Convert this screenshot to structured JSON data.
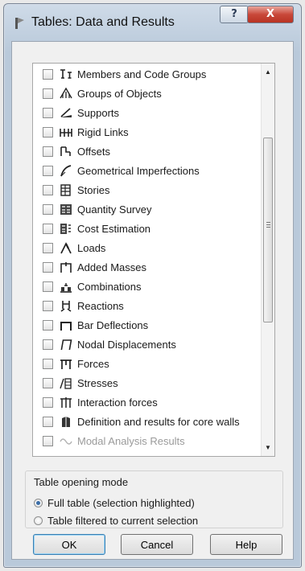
{
  "window": {
    "title": "Tables: Data and Results",
    "help_label": "?",
    "close_label": "X"
  },
  "list": {
    "items": [
      {
        "label": "Members and Code Groups",
        "icon": "members-icon",
        "checked": false
      },
      {
        "label": "Groups of Objects",
        "icon": "groups-icon",
        "checked": false
      },
      {
        "label": "Supports",
        "icon": "supports-icon",
        "checked": false
      },
      {
        "label": "Rigid Links",
        "icon": "rigid-links-icon",
        "checked": false
      },
      {
        "label": "Offsets",
        "icon": "offsets-icon",
        "checked": false
      },
      {
        "label": "Geometrical Imperfections",
        "icon": "imperfections-icon",
        "checked": false
      },
      {
        "label": "Stories",
        "icon": "stories-icon",
        "checked": false
      },
      {
        "label": "Quantity Survey",
        "icon": "quantity-survey-icon",
        "checked": false
      },
      {
        "label": "Cost Estimation",
        "icon": "cost-estimation-icon",
        "checked": false
      },
      {
        "label": "Loads",
        "icon": "loads-icon",
        "checked": false
      },
      {
        "label": "Added Masses",
        "icon": "added-masses-icon",
        "checked": false
      },
      {
        "label": "Combinations",
        "icon": "combinations-icon",
        "checked": false
      },
      {
        "label": "Reactions",
        "icon": "reactions-icon",
        "checked": false
      },
      {
        "label": "Bar Deflections",
        "icon": "bar-deflections-icon",
        "checked": false
      },
      {
        "label": "Nodal Displacements",
        "icon": "nodal-displacements-icon",
        "checked": false
      },
      {
        "label": "Forces",
        "icon": "forces-icon",
        "checked": false
      },
      {
        "label": "Stresses",
        "icon": "stresses-icon",
        "checked": false
      },
      {
        "label": "Interaction forces",
        "icon": "interaction-forces-icon",
        "checked": false
      },
      {
        "label": "Definition and results for core walls",
        "icon": "core-walls-icon",
        "checked": false
      },
      {
        "label": "Modal Analysis Results",
        "icon": "modal-analysis-icon",
        "checked": false,
        "disabled": true
      }
    ]
  },
  "mode": {
    "title": "Table opening mode",
    "options": [
      {
        "label": "Full table (selection highlighted)",
        "checked": true
      },
      {
        "label": "Table filtered to current selection",
        "checked": false
      }
    ]
  },
  "buttons": {
    "ok": "OK",
    "cancel": "Cancel",
    "help": "Help"
  },
  "colors": {
    "title_bar": "#b9c9da",
    "close_button": "#c9483a",
    "dialog_bg": "#f0f0f0",
    "radio_selected": "#3b6ea8"
  }
}
